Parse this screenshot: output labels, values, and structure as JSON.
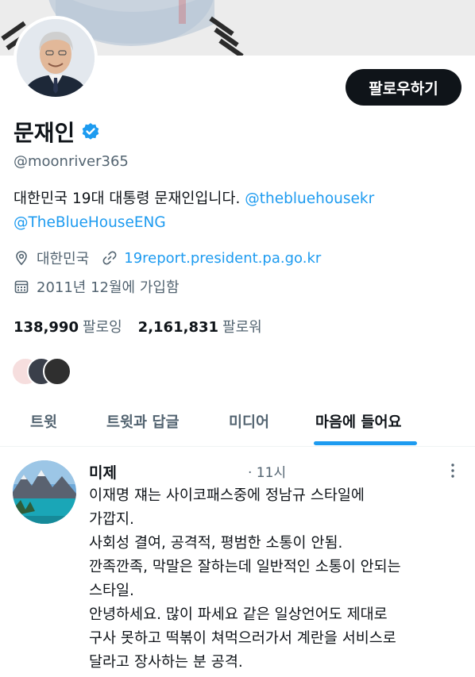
{
  "profile": {
    "name": "문재인",
    "handle": "@moonriver365",
    "follow_button": "팔로우하기",
    "bio_text": "대한민국 19대 대통령 문재인입니다.",
    "bio_mention_1": "@thebluehousekr",
    "bio_mention_2": "@TheBlueHouseENG",
    "location": "대한민국",
    "website": "19report.president.pa.go.kr",
    "joined": "2011년 12월에 가입함",
    "following_count": "138,990",
    "following_label": "팔로잉",
    "followers_count": "2,161,831",
    "followers_label": "팔로워",
    "icons": {
      "verified": "verified-badge-icon",
      "location": "location-pin-icon",
      "link": "link-icon",
      "calendar": "calendar-icon"
    }
  },
  "tabs": [
    {
      "label": "트윗"
    },
    {
      "label": "트윗과 답글"
    },
    {
      "label": "미디어"
    },
    {
      "label": "마음에 들어요",
      "active": true
    }
  ],
  "tweet": {
    "author": "미제",
    "time": "· 11시",
    "lines": [
      "이재명 쟤는 사이코패스중에 정남규 스타일에",
      "가깝지.",
      "사회성 결여, 공격적, 평범한 소통이 안됨.",
      "깐족깐족, 막말은 잘하는데 일반적인 소통이 안되는",
      "스타일.",
      "안녕하세요. 많이 파세요 같은 일상언어도 제대로",
      "구사 못하고 떡볶이 쳐먹으러가서 계란을 서비스로",
      "달라고 장사하는 분 공격."
    ]
  },
  "colors": {
    "accent": "#1d9bf0",
    "text": "#0f1419",
    "secondary": "#536471",
    "button_bg": "#0f1419"
  }
}
